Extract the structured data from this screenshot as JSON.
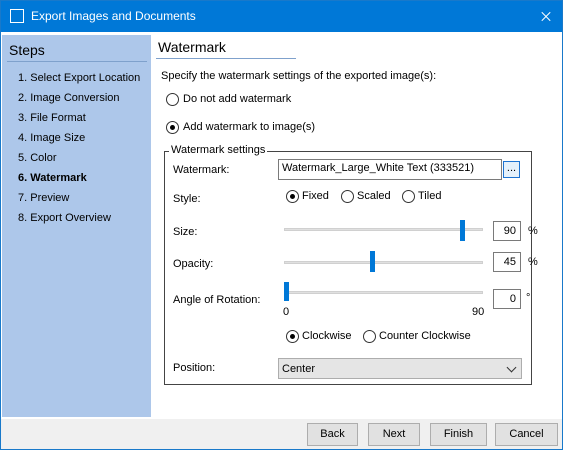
{
  "window": {
    "title": "Export Images and Documents"
  },
  "sidebar": {
    "header": "Steps",
    "items": [
      {
        "label": "1. Select Export Location",
        "active": false
      },
      {
        "label": "2. Image Conversion",
        "active": false
      },
      {
        "label": "3. File Format",
        "active": false
      },
      {
        "label": "4. Image Size",
        "active": false
      },
      {
        "label": "5. Color",
        "active": false
      },
      {
        "label": "6. Watermark",
        "active": true
      },
      {
        "label": "7. Preview",
        "active": false
      },
      {
        "label": "8. Export Overview",
        "active": false
      }
    ]
  },
  "main": {
    "title": "Watermark",
    "description": "Specify the watermark settings of the exported image(s):",
    "options": {
      "none_label": "Do not add watermark",
      "add_label": "Add watermark to image(s)",
      "selected": "add"
    },
    "settings": {
      "legend": "Watermark settings",
      "watermark_label": "Watermark:",
      "watermark_value": "Watermark_Large_White Text (333521)",
      "browse_label": "...",
      "style_label": "Style:",
      "styles": [
        "Fixed",
        "Scaled",
        "Tiled"
      ],
      "style_selected": "Fixed",
      "size_label": "Size:",
      "size_value": "90",
      "size_unit": "%",
      "opacity_label": "Opacity:",
      "opacity_value": "45",
      "opacity_unit": "%",
      "rotation_label": "Angle of Rotation:",
      "rotation_value": "0",
      "rotation_unit": "°",
      "rotation_min": "0",
      "rotation_max": "90",
      "direction_options": [
        "Clockwise",
        "Counter Clockwise"
      ],
      "direction_selected": "Clockwise",
      "position_label": "Position:",
      "position_value": "Center"
    }
  },
  "footer": {
    "back_label": "Back",
    "next_label": "Next",
    "finish_label": "Finish",
    "cancel_label": "Cancel"
  },
  "colors": {
    "titlebar": "#0078d7",
    "sidebar": "#adc7ea",
    "accent": "#0078d7"
  }
}
